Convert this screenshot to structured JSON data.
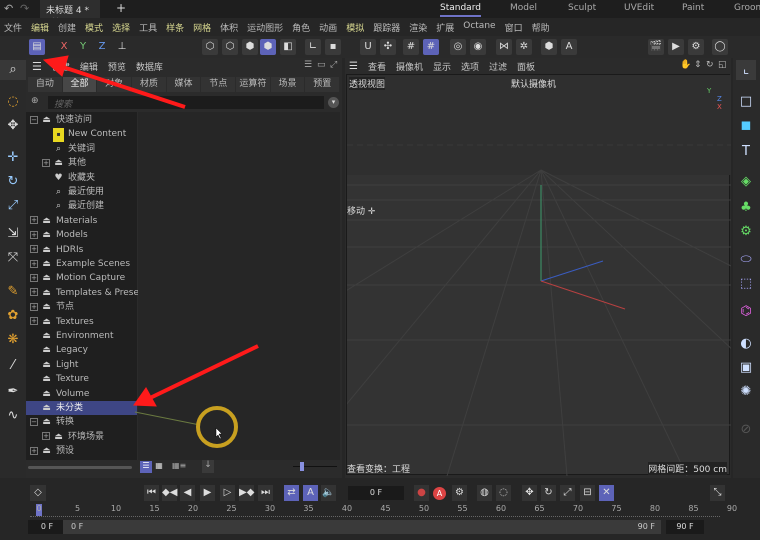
{
  "titlebar": {
    "doc_title": "未标题 4 *",
    "close": "×",
    "new_tab": "+",
    "workspaces": [
      "Standard",
      "Model",
      "Sculpt",
      "UVEdit",
      "Paint",
      "Groom"
    ],
    "active_workspace": "Standard"
  },
  "menu": [
    "文件",
    "编辑",
    "创建",
    "模式",
    "选择",
    "工具",
    "样条",
    "网格",
    "体积",
    "运动图形",
    "角色",
    "动画",
    "模拟",
    "跟踪器",
    "渲染",
    "扩展",
    "Octane",
    "窗口",
    "帮助"
  ],
  "toolbar": {
    "axis": [
      "X",
      "Y",
      "Z"
    ]
  },
  "content_browser": {
    "menu": [
      "创建",
      "编辑",
      "预览",
      "数据库"
    ],
    "tabs": [
      "自动",
      "全部",
      "对象",
      "材质",
      "媒体",
      "节点",
      "运算符",
      "场景",
      "预置"
    ],
    "active_tab": "全部",
    "search_placeholder": "搜索",
    "tree": [
      {
        "label": "快速访问",
        "depth": 0,
        "expander": "−",
        "icon": "folder"
      },
      {
        "label": "New Content",
        "depth": 1,
        "icon": "new-folder"
      },
      {
        "label": "关键词",
        "depth": 1,
        "icon": "search"
      },
      {
        "label": "其他",
        "depth": 1,
        "expander": "+",
        "icon": "folder"
      },
      {
        "label": "收藏夹",
        "depth": 1,
        "icon": "heart"
      },
      {
        "label": "最近使用",
        "depth": 1,
        "icon": "search"
      },
      {
        "label": "最近创建",
        "depth": 1,
        "icon": "search"
      },
      {
        "label": "Materials",
        "depth": 0,
        "expander": "+",
        "icon": "folder"
      },
      {
        "label": "Models",
        "depth": 0,
        "expander": "+",
        "icon": "folder"
      },
      {
        "label": "HDRIs",
        "depth": 0,
        "expander": "+",
        "icon": "folder"
      },
      {
        "label": "Example Scenes",
        "depth": 0,
        "expander": "+",
        "icon": "folder"
      },
      {
        "label": "Motion Capture",
        "depth": 0,
        "expander": "+",
        "icon": "folder"
      },
      {
        "label": "Templates & Presets",
        "depth": 0,
        "expander": "+",
        "icon": "folder"
      },
      {
        "label": "节点",
        "depth": 0,
        "expander": "+",
        "icon": "folder"
      },
      {
        "label": "Textures",
        "depth": 0,
        "expander": "+",
        "icon": "folder"
      },
      {
        "label": "Environment",
        "depth": 0,
        "icon": "folder"
      },
      {
        "label": "Legacy",
        "depth": 0,
        "icon": "folder"
      },
      {
        "label": "Light",
        "depth": 0,
        "icon": "folder"
      },
      {
        "label": "Texture",
        "depth": 0,
        "icon": "folder"
      },
      {
        "label": "Volume",
        "depth": 0,
        "icon": "folder"
      },
      {
        "label": "未分类",
        "depth": 0,
        "icon": "folder",
        "selected": true
      },
      {
        "label": "转换",
        "depth": 0,
        "expander": "−",
        "icon": "folder"
      },
      {
        "label": "环境场景",
        "depth": 1,
        "expander": "+",
        "icon": "folder"
      },
      {
        "label": "预设",
        "depth": 0,
        "expander": "+",
        "icon": "folder"
      }
    ]
  },
  "viewport": {
    "menu": [
      "查看",
      "摄像机",
      "显示",
      "选项",
      "过滤",
      "面板"
    ],
    "view_name": "透视视图",
    "camera": "默认摄像机",
    "tool": "移动",
    "status_left": "查看变换：工程",
    "status_right": "网格间距：500 cm",
    "gizmo": [
      "Y",
      "Z",
      "X"
    ]
  },
  "timeline": {
    "current_frame": "0 F",
    "ticks": [
      "0",
      "5",
      "10",
      "15",
      "20",
      "25",
      "30",
      "35",
      "40",
      "45",
      "50",
      "55",
      "60",
      "65",
      "70",
      "75",
      "80",
      "85",
      "90"
    ],
    "start": "0 F",
    "range_start": "0 F",
    "range_end": "90 F",
    "end": "90 F"
  },
  "colors": {
    "accent": "#5d63b8",
    "selection": "#3e4685",
    "annotation_arrow": "#ff1a1a",
    "cursor_ring": "#c8a020"
  }
}
